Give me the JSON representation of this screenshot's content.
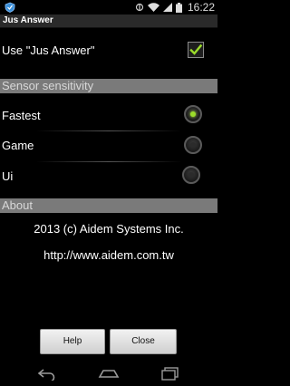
{
  "status_bar": {
    "left_icon": "shield-icon",
    "icons": [
      "signal-icon",
      "wifi-icon",
      "cell-signal-icon",
      "battery-icon"
    ],
    "time": "16:22"
  },
  "app": {
    "title": "Jus Answer"
  },
  "settings": {
    "use_label": "Use \"Jus Answer\"",
    "use_checked": true
  },
  "sensor": {
    "header": "Sensor sensitivity",
    "options": [
      {
        "label": "Fastest",
        "selected": true
      },
      {
        "label": "Game",
        "selected": false
      },
      {
        "label": "Ui",
        "selected": false
      }
    ]
  },
  "about": {
    "header": "About",
    "line1": "2013 (c) Aidem Systems Inc.",
    "line2": "http://www.aidem.com.tw"
  },
  "buttons": {
    "help": "Help",
    "close": "Close"
  },
  "colors": {
    "accent": "#9bdc2a",
    "header_bg": "#7a7a7a"
  },
  "nav_bar": {
    "icons": [
      "back-icon",
      "home-icon",
      "recents-icon"
    ]
  }
}
